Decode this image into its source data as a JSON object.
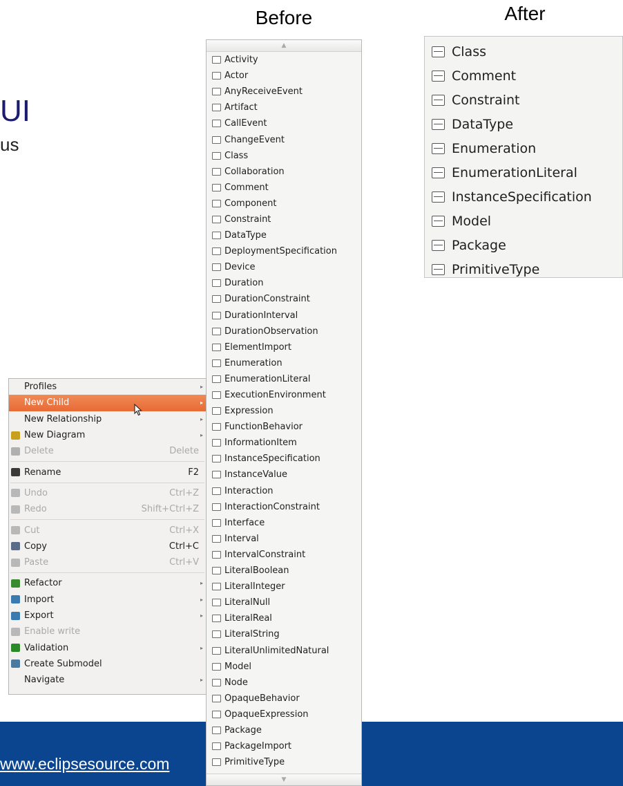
{
  "slide": {
    "title_fragment": "UI",
    "subtitle_fragment": "us",
    "footer_link": "www.eclipsesource.com"
  },
  "captions": {
    "before": "Before",
    "after": "After"
  },
  "before_list": {
    "items": [
      {
        "label": "Activity",
        "icon": "activity-icon"
      },
      {
        "label": "Actor",
        "icon": "actor-icon"
      },
      {
        "label": "AnyReceiveEvent",
        "icon": "any-receive-event-icon"
      },
      {
        "label": "Artifact",
        "icon": "artifact-icon"
      },
      {
        "label": "CallEvent",
        "icon": "call-event-icon"
      },
      {
        "label": "ChangeEvent",
        "icon": "change-event-icon"
      },
      {
        "label": "Class",
        "icon": "class-icon"
      },
      {
        "label": "Collaboration",
        "icon": "collaboration-icon"
      },
      {
        "label": "Comment",
        "icon": "comment-icon"
      },
      {
        "label": "Component",
        "icon": "component-icon"
      },
      {
        "label": "Constraint",
        "icon": "constraint-icon"
      },
      {
        "label": "DataType",
        "icon": "datatype-icon"
      },
      {
        "label": "DeploymentSpecification",
        "icon": "deployment-specification-icon"
      },
      {
        "label": "Device",
        "icon": "device-icon"
      },
      {
        "label": "Duration",
        "icon": "duration-icon"
      },
      {
        "label": "DurationConstraint",
        "icon": "duration-constraint-icon"
      },
      {
        "label": "DurationInterval",
        "icon": "duration-interval-icon"
      },
      {
        "label": "DurationObservation",
        "icon": "duration-observation-icon"
      },
      {
        "label": "ElementImport",
        "icon": "element-import-icon"
      },
      {
        "label": "Enumeration",
        "icon": "enumeration-icon"
      },
      {
        "label": "EnumerationLiteral",
        "icon": "enumeration-literal-icon"
      },
      {
        "label": "ExecutionEnvironment",
        "icon": "execution-environment-icon"
      },
      {
        "label": "Expression",
        "icon": "expression-icon"
      },
      {
        "label": "FunctionBehavior",
        "icon": "function-behavior-icon"
      },
      {
        "label": "InformationItem",
        "icon": "information-item-icon"
      },
      {
        "label": "InstanceSpecification",
        "icon": "instance-specification-icon"
      },
      {
        "label": "InstanceValue",
        "icon": "instance-value-icon"
      },
      {
        "label": "Interaction",
        "icon": "interaction-icon"
      },
      {
        "label": "InteractionConstraint",
        "icon": "interaction-constraint-icon"
      },
      {
        "label": "Interface",
        "icon": "interface-icon"
      },
      {
        "label": "Interval",
        "icon": "interval-icon"
      },
      {
        "label": "IntervalConstraint",
        "icon": "interval-constraint-icon"
      },
      {
        "label": "LiteralBoolean",
        "icon": "literal-boolean-icon"
      },
      {
        "label": "LiteralInteger",
        "icon": "literal-integer-icon"
      },
      {
        "label": "LiteralNull",
        "icon": "literal-null-icon"
      },
      {
        "label": "LiteralReal",
        "icon": "literal-real-icon"
      },
      {
        "label": "LiteralString",
        "icon": "literal-string-icon"
      },
      {
        "label": "LiteralUnlimitedNatural",
        "icon": "literal-unlimited-natural-icon"
      },
      {
        "label": "Model",
        "icon": "model-icon"
      },
      {
        "label": "Node",
        "icon": "node-icon"
      },
      {
        "label": "OpaqueBehavior",
        "icon": "opaque-behavior-icon"
      },
      {
        "label": "OpaqueExpression",
        "icon": "opaque-expression-icon"
      },
      {
        "label": "Package",
        "icon": "package-icon"
      },
      {
        "label": "PackageImport",
        "icon": "package-import-icon"
      },
      {
        "label": "PrimitiveType",
        "icon": "primitive-type-icon"
      }
    ]
  },
  "after_list": {
    "items": [
      {
        "label": "Class",
        "icon": "class-icon"
      },
      {
        "label": "Comment",
        "icon": "comment-icon"
      },
      {
        "label": "Constraint",
        "icon": "constraint-icon"
      },
      {
        "label": "DataType",
        "icon": "datatype-icon"
      },
      {
        "label": "Enumeration",
        "icon": "enumeration-icon"
      },
      {
        "label": "EnumerationLiteral",
        "icon": "enumeration-literal-icon"
      },
      {
        "label": "InstanceSpecification",
        "icon": "instance-specification-icon"
      },
      {
        "label": "Model",
        "icon": "model-icon"
      },
      {
        "label": "Package",
        "icon": "package-icon"
      },
      {
        "label": "PrimitiveType",
        "icon": "primitive-type-icon"
      }
    ]
  },
  "context_menu": {
    "items": [
      {
        "label": "Profiles",
        "submenu": true,
        "enabled": true
      },
      {
        "label": "New Child",
        "submenu": true,
        "enabled": true,
        "selected": true
      },
      {
        "label": "New Relationship",
        "submenu": true,
        "enabled": true
      },
      {
        "label": "New Diagram",
        "icon": "new-diagram-icon",
        "submenu": true,
        "enabled": true
      },
      {
        "label": "Delete",
        "icon": "delete-icon",
        "shortcut": "Delete",
        "enabled": false
      },
      {
        "separator": true
      },
      {
        "label": "Rename",
        "icon": "rename-icon",
        "shortcut": "F2",
        "enabled": true
      },
      {
        "separator": true
      },
      {
        "label": "Undo",
        "icon": "undo-icon",
        "shortcut": "Ctrl+Z",
        "enabled": false
      },
      {
        "label": "Redo",
        "icon": "redo-icon",
        "shortcut": "Shift+Ctrl+Z",
        "enabled": false
      },
      {
        "separator": true
      },
      {
        "label": "Cut",
        "icon": "cut-icon",
        "shortcut": "Ctrl+X",
        "enabled": false
      },
      {
        "label": "Copy",
        "icon": "copy-icon",
        "shortcut": "Ctrl+C",
        "enabled": true
      },
      {
        "label": "Paste",
        "icon": "paste-icon",
        "shortcut": "Ctrl+V",
        "enabled": false
      },
      {
        "separator": true
      },
      {
        "label": "Refactor",
        "icon": "refactor-icon",
        "submenu": true,
        "enabled": true
      },
      {
        "label": "Import",
        "icon": "import-icon",
        "submenu": true,
        "enabled": true
      },
      {
        "label": "Export",
        "icon": "export-icon",
        "submenu": true,
        "enabled": true
      },
      {
        "label": "Enable write",
        "icon": "enable-write-icon",
        "enabled": false
      },
      {
        "label": "Validation",
        "icon": "validation-check-icon",
        "submenu": true,
        "enabled": true
      },
      {
        "label": "Create Submodel",
        "icon": "create-submodel-icon",
        "enabled": true
      },
      {
        "label": "Navigate",
        "submenu": true,
        "enabled": true
      }
    ]
  },
  "colors": {
    "selection": "#e8703a",
    "footer_band": "#0b4590",
    "title": "#1c1c6e"
  }
}
